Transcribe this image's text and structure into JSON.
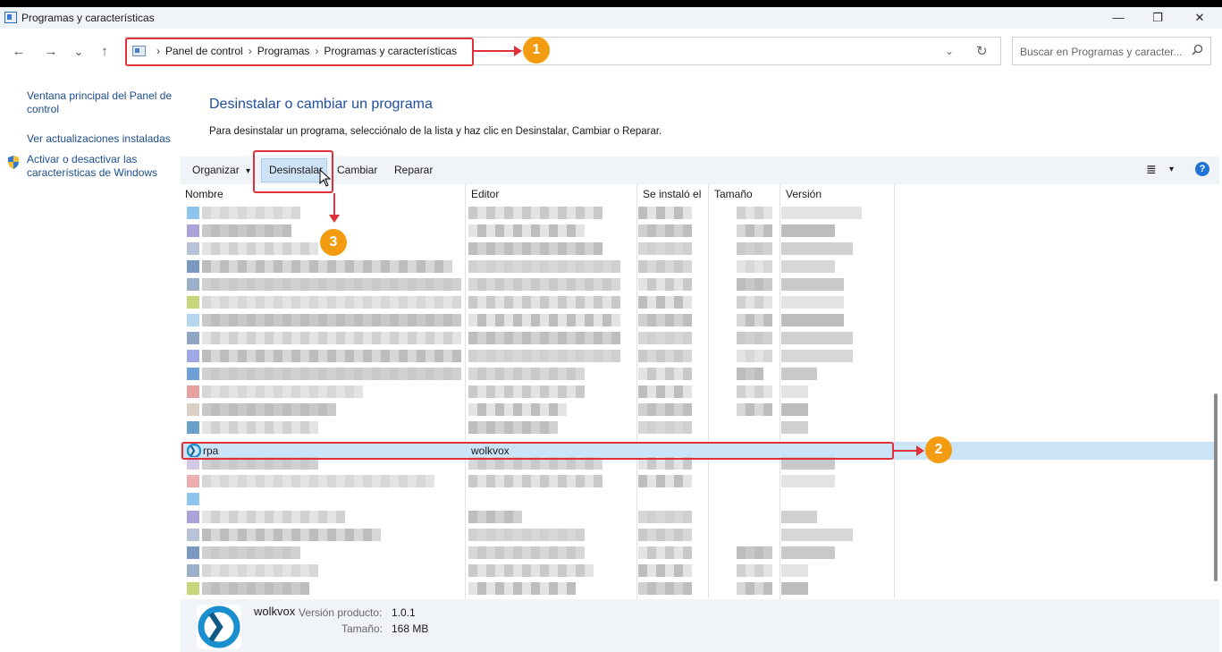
{
  "window": {
    "title": "Programas y características",
    "minimize": "—",
    "restore": "❐",
    "close": "✕"
  },
  "nav": {
    "back": "←",
    "forward": "→",
    "recent": "⌄",
    "up": "↑"
  },
  "address": {
    "crumbs": [
      "Panel de control",
      "Programas",
      "Programas y características"
    ],
    "separator": "›",
    "dropdown": "⌄",
    "refresh": "↻"
  },
  "search": {
    "placeholder": "Buscar en Programas y caracter...",
    "icon": "search-icon"
  },
  "sidebar": {
    "items": [
      {
        "label": "Ventana principal del Panel de control"
      },
      {
        "label": "Ver actualizaciones instaladas"
      },
      {
        "label": "Activar o desactivar las características de Windows",
        "icon": "shield-icon"
      }
    ]
  },
  "main": {
    "heading": "Desinstalar o cambiar un programa",
    "instructions": "Para desinstalar un programa, selecciónalo de la lista y haz clic en Desinstalar, Cambiar o Reparar."
  },
  "toolbar": {
    "organize": "Organizar",
    "organize_arrow": "▾",
    "uninstall": "Desinstalar",
    "change": "Cambiar",
    "repair": "Reparar",
    "view_icon": "≣",
    "view_arrow": "▾",
    "help": "?"
  },
  "columns": [
    "Nombre",
    "Editor",
    "Se instaló el",
    "Tamaño",
    "Versión"
  ],
  "selected_program": {
    "name": "rpa",
    "publisher": "wolkvox"
  },
  "details": {
    "name": "wolkvox",
    "version_label": "Versión producto:",
    "version": "1.0.1",
    "size_label": "Tamaño:",
    "size": "168 MB"
  },
  "annotations": [
    "1",
    "2",
    "3"
  ],
  "colors": {
    "accent": "#1f4ea0",
    "annotation_red": "#e0313a",
    "marker_orange": "#f39c12",
    "selection": "#cce4f7"
  }
}
